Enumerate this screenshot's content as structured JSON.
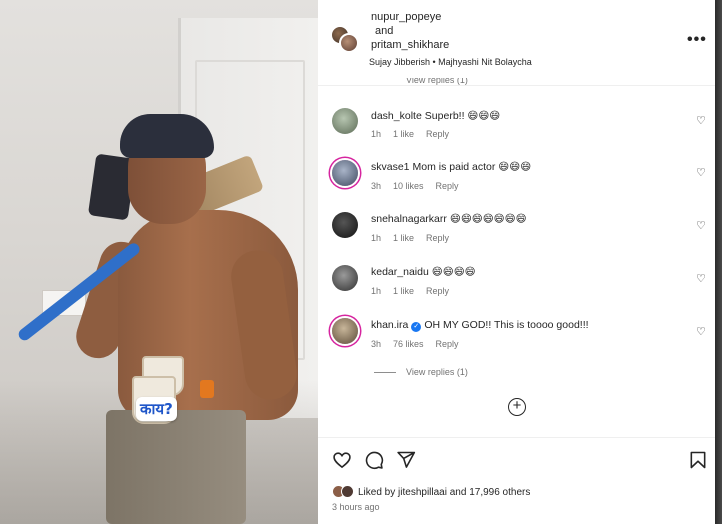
{
  "post": {
    "author_1": "nupur_popeye",
    "and_text": "and",
    "author_2": "pritam_shikhare",
    "audio": "Sujay Jibberish • Majhyashi Nit Bolaycha",
    "sticker_text": "काय?",
    "hidden_replies_text": "View replies (1)"
  },
  "comments": [
    {
      "user": "dash_kolte",
      "text": "Superb!! 😄😄😄",
      "time": "1h",
      "likes": "1 like",
      "reply": "Reply"
    },
    {
      "user": "skvase1",
      "text": "Mom is paid actor 😄😄😄",
      "time": "3h",
      "likes": "10 likes",
      "reply": "Reply"
    },
    {
      "user": "snehalnagarkarr",
      "text": "😄😄😄😄😄😄😄",
      "time": "1h",
      "likes": "1 like",
      "reply": "Reply"
    },
    {
      "user": "kedar_naidu",
      "text": "😄😄😄😄",
      "time": "1h",
      "likes": "1 like",
      "reply": "Reply"
    },
    {
      "user": "khan.ira",
      "text": "OH MY GOD!! This is toooo good!!!",
      "time": "3h",
      "likes": "76 likes",
      "reply": "Reply",
      "verified": true
    }
  ],
  "view_replies": "View replies (1)",
  "footer": {
    "liked_prefix": "Liked by",
    "liked_user": "jiteshpillaai",
    "liked_suffix": "and 17,996 others",
    "time_ago": "3 hours ago"
  },
  "icons": {
    "more": "more-options-icon",
    "heart": "heart-icon",
    "comment": "comment-icon",
    "share": "share-icon",
    "save": "bookmark-icon",
    "add": "add-circle-icon"
  },
  "colors": {
    "text": "#262626",
    "muted": "#737373",
    "verified": "#1877f2",
    "story_ring": "#d6249f",
    "sticker": "#1f56c9"
  }
}
